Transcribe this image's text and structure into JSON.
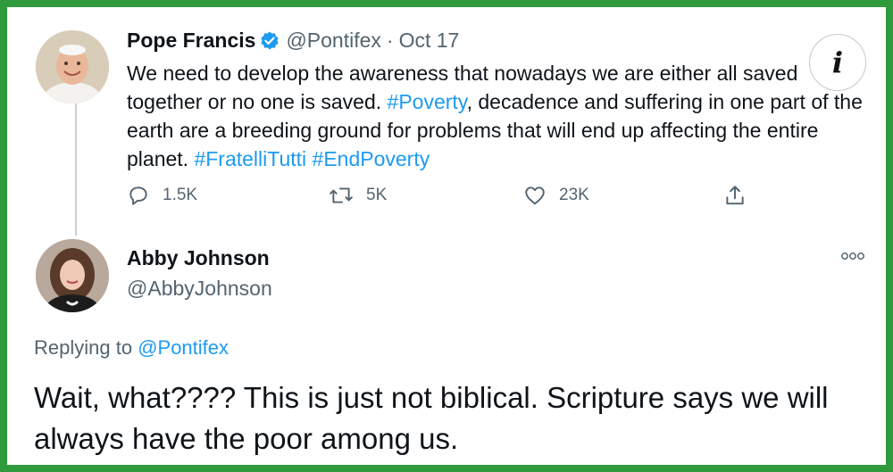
{
  "tweet": {
    "author_name": "Pope Francis",
    "author_handle": "@Pontifex",
    "separator": "·",
    "date": "Oct 17",
    "text_segments": {
      "part1": "We need to develop the awareness that nowadays we are either all saved together or no one is saved. ",
      "hashtag1": "#Poverty",
      "part2": ", decadence and suffering in one part of the earth are a breeding ground for problems that will end up affecting the entire planet. ",
      "hashtag2": "#FratelliTutti",
      "space": " ",
      "hashtag3": "#EndPoverty"
    },
    "replies_count": "1.5K",
    "retweets_count": "5K",
    "likes_count": "23K",
    "icons": [
      "verified-badge-icon",
      "reply-icon",
      "retweet-icon",
      "like-icon",
      "share-icon"
    ]
  },
  "info_badge": {
    "label": "i"
  },
  "reply": {
    "author_name": "Abby Johnson",
    "author_handle": "@AbbyJohnson",
    "replying_prefix": "Replying to ",
    "replying_to": "@Pontifex",
    "text": "Wait, what???? This is just not biblical. Scripture says we will always have the poor among us.",
    "icons": [
      "more-options-icon"
    ]
  },
  "colors": {
    "border_green": "#2e9a3c",
    "link_blue": "#1d9bf0",
    "muted_gray": "#536471",
    "text_dark": "#0f1419"
  }
}
